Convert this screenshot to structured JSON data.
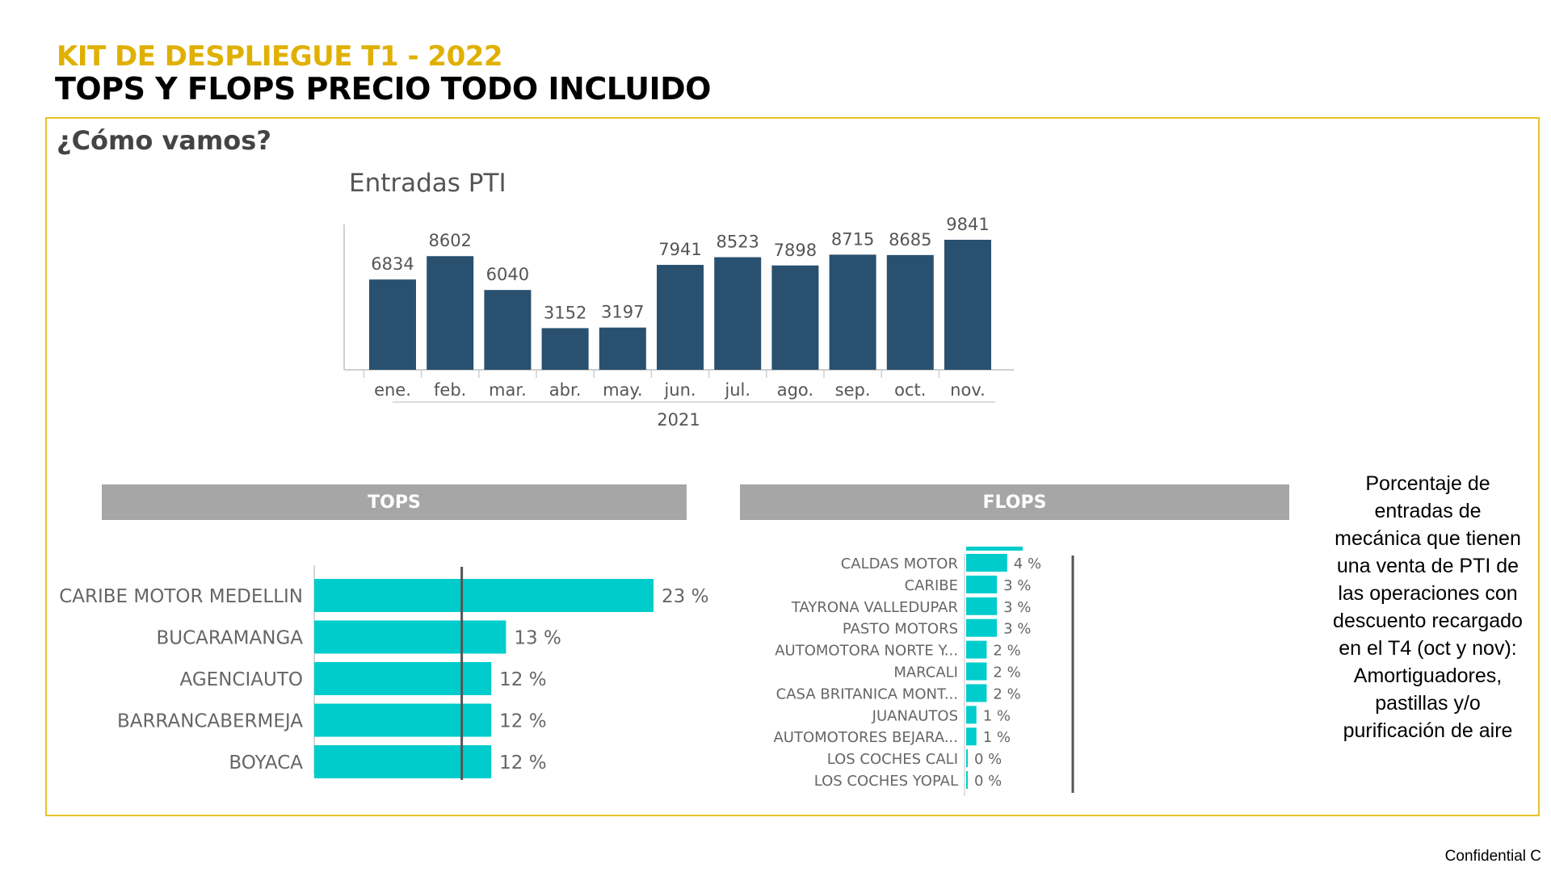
{
  "header": {
    "kit_title": "KIT DE DESPLIEGUE T1 - 2022",
    "main_title": "TOPS Y FLOPS PRECIO TODO INCLUIDO",
    "question": "¿Cómo vamos?"
  },
  "colors": {
    "accent_gold": "#e0b000",
    "bar_navy": "#29506f",
    "bar_cyan": "#00cccc",
    "section_gray": "#a6a6a6",
    "frame_border": "#e6c32a"
  },
  "sections": {
    "tops_label": "TOPS",
    "flops_label": "FLOPS"
  },
  "side_note": "Porcentaje de entradas de mecánica que tienen una venta de PTI  de las operaciones con descuento recargado en el T4 (oct y nov): Amortiguadores, pastillas y/o purificación de aire",
  "footer": {
    "confidential": "Confidential C"
  },
  "chart_data": [
    {
      "type": "bar",
      "title": "Entradas PTI",
      "categories": [
        "ene.",
        "feb.",
        "mar.",
        "abr.",
        "may.",
        "jun.",
        "jul.",
        "ago.",
        "sep.",
        "oct.",
        "nov."
      ],
      "values": [
        6834,
        8602,
        6040,
        3152,
        3197,
        7941,
        8523,
        7898,
        8715,
        8685,
        9841
      ],
      "group_label": "2021",
      "data_labels": true
    },
    {
      "type": "bar",
      "orientation": "horizontal",
      "categories": [
        "CARIBE MOTOR MEDELLIN",
        "BUCARAMANGA",
        "AGENCIAUTO",
        "BARRANCABERMEJA",
        "BOYACA"
      ],
      "values": [
        23,
        13,
        12,
        12,
        12
      ],
      "labels": [
        "23 %",
        "13 %",
        "12 %",
        "12 %",
        "12 %"
      ],
      "reference_line": 10
    },
    {
      "type": "bar",
      "orientation": "horizontal",
      "categories": [
        "CALDAS MOTOR",
        "CARIBE",
        "TAYRONA VALLEDUPAR",
        "PASTO MOTORS",
        "AUTOMOTORA NORTE Y...",
        "MARCALI",
        "CASA BRITANICA MONT...",
        "JUANAUTOS",
        "AUTOMOTORES BEJARA...",
        "LOS COCHES CALI",
        "LOS COCHES YOPAL"
      ],
      "values": [
        4,
        3,
        3,
        3,
        2,
        2,
        2,
        1,
        1,
        0,
        0
      ],
      "labels": [
        "4 %",
        "3 %",
        "3 %",
        "3 %",
        "2 %",
        "2 %",
        "2 %",
        "1 %",
        "1 %",
        "0 %",
        "0 %"
      ],
      "reference_line": 10
    }
  ]
}
